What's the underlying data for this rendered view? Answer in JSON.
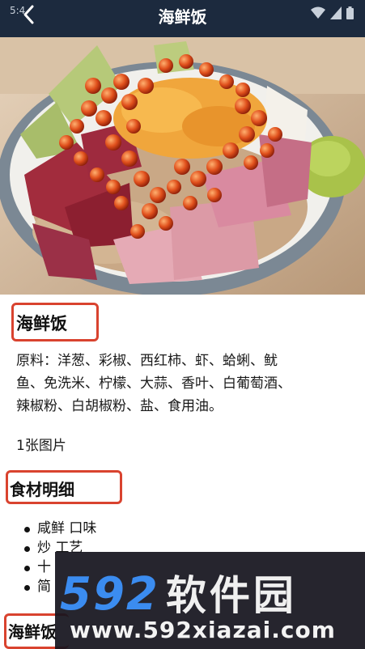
{
  "status_bar": {
    "time": "5:4"
  },
  "header": {
    "title": "海鲜饭",
    "back_icon": "back-arrow-icon"
  },
  "hero": {
    "image": "seafood-rice-bowl"
  },
  "recipe": {
    "title": "海鲜饭",
    "ingredients_line1": "原料：洋葱、彩椒、西红柿、虾、蛤蜊、鱿",
    "ingredients_line2": "鱼、免洗米、柠檬、大蒜、香叶、白葡萄酒、",
    "ingredients_line3": "辣椒粉、白胡椒粉、盐、食用油。",
    "photo_count": "1张图片"
  },
  "details_section": {
    "title": "食材明细",
    "items": [
      "咸鲜 口味",
      "炒 工艺",
      "十",
      "简"
    ]
  },
  "next_section": {
    "title": "海鲜饭"
  },
  "watermark": {
    "brand_number": "592",
    "brand_text": "软件园",
    "url": "www.592xiazai.com",
    "brand_color": "#3b8cf0"
  },
  "colors": {
    "header_bg": "#1c2a3e",
    "highlight_border": "#d9432f"
  }
}
